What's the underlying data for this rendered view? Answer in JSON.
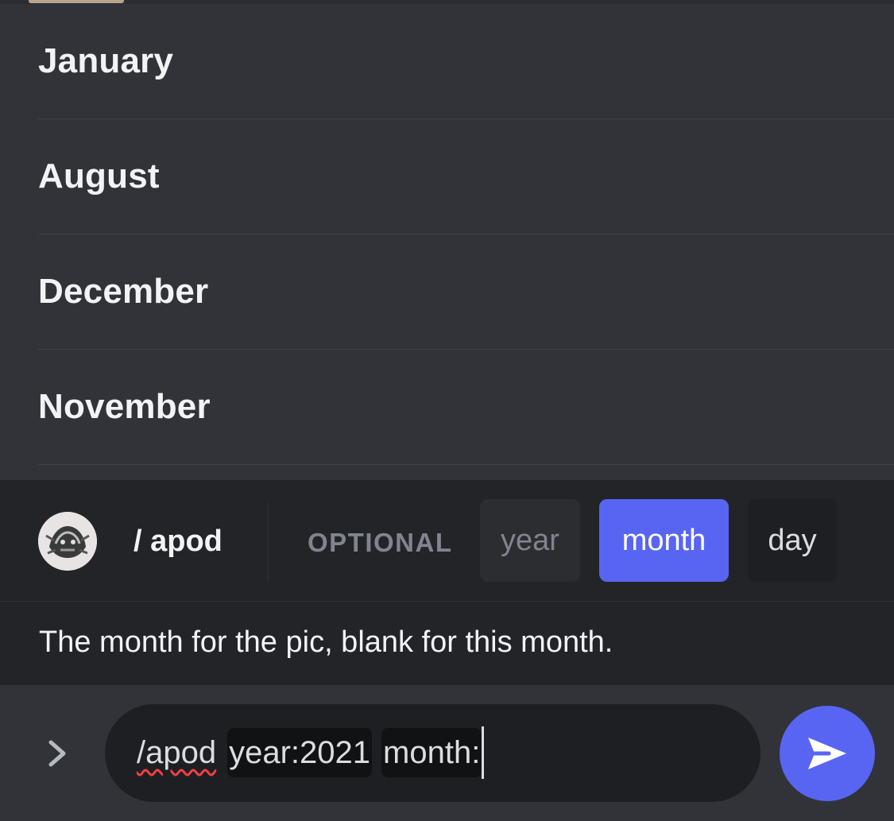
{
  "months": {
    "items": [
      {
        "label": "January"
      },
      {
        "label": "August"
      },
      {
        "label": "December"
      },
      {
        "label": "November"
      }
    ]
  },
  "command_bar": {
    "command": "/ apod",
    "optional_label": "OPTIONAL",
    "options": [
      {
        "label": "year",
        "state": "filled"
      },
      {
        "label": "month",
        "state": "active"
      },
      {
        "label": "day",
        "state": "empty"
      }
    ]
  },
  "description": {
    "text": "The month for the pic, blank for this month."
  },
  "input": {
    "command_text": "/apod",
    "year_param": "year:2021",
    "month_param": "month:"
  },
  "colors": {
    "accent": "#5865f2",
    "background": "#313338",
    "panel": "#232428",
    "input_bg": "#1e1f22"
  },
  "icons": {
    "expand": "chevron-right-icon",
    "emoji": "emoji-icon",
    "send": "send-icon"
  }
}
